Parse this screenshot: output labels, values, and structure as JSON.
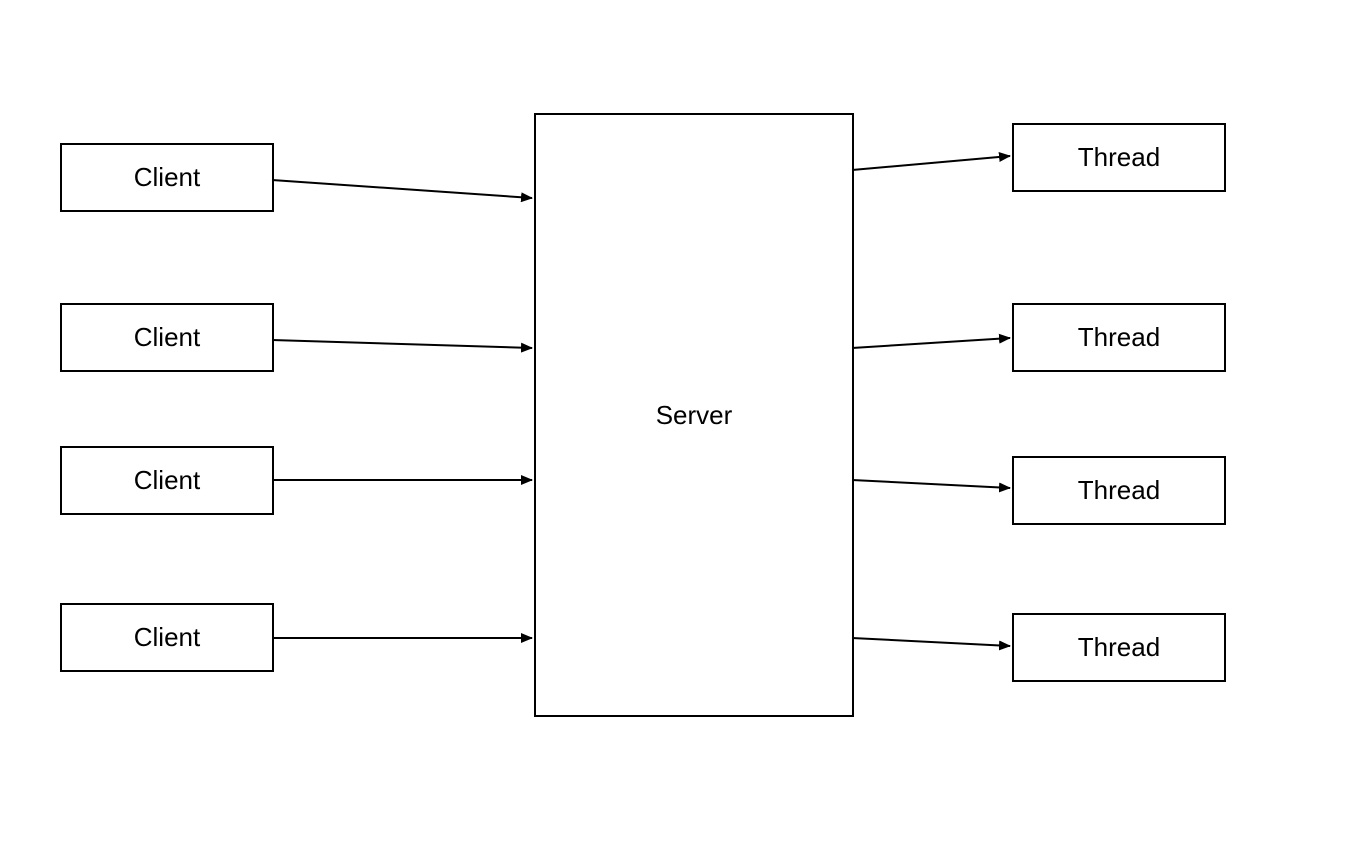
{
  "clients": [
    {
      "label": "Client"
    },
    {
      "label": "Client"
    },
    {
      "label": "Client"
    },
    {
      "label": "Client"
    }
  ],
  "server": {
    "label": "Server"
  },
  "threads": [
    {
      "label": "Thread"
    },
    {
      "label": "Thread"
    },
    {
      "label": "Thread"
    },
    {
      "label": "Thread"
    }
  ]
}
